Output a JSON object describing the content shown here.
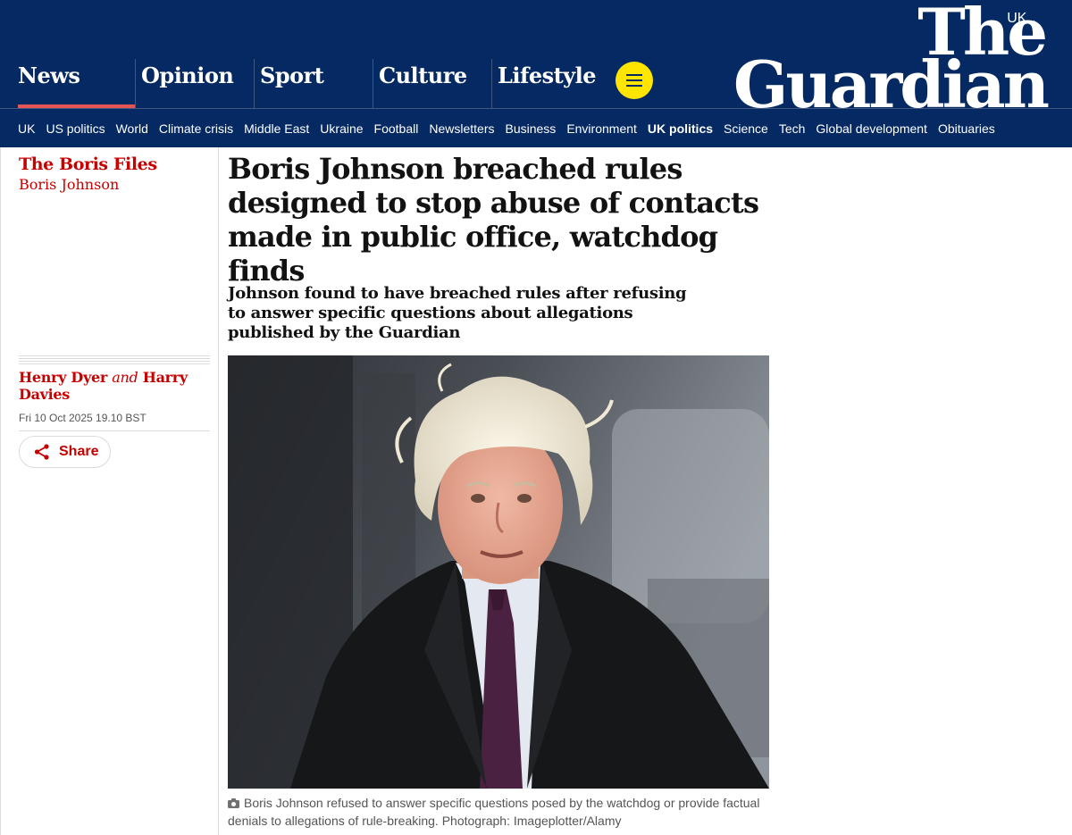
{
  "header": {
    "edition": "UK",
    "logo_line1": "The",
    "logo_line2": "Guardian",
    "pillars": [
      "News",
      "Opinion",
      "Sport",
      "Culture",
      "Lifestyle"
    ],
    "active_pillar": "News",
    "subnav": [
      "UK",
      "US politics",
      "World",
      "Climate crisis",
      "Middle East",
      "Ukraine",
      "Football",
      "Newsletters",
      "Business",
      "Environment",
      "UK politics",
      "Science",
      "Tech",
      "Global development",
      "Obituaries"
    ],
    "subnav_active": "UK politics"
  },
  "article": {
    "series": "The Boris Files",
    "series_tag": "Boris Johnson",
    "headline": "Boris Johnson breached rules designed to stop abuse of contacts made in public office, watchdog finds",
    "standfirst": "Johnson found to have breached rules after refusing to answer specific questions about allegations published by the Guardian",
    "author1": "Henry Dyer",
    "author_joiner": "and",
    "author2": "Harry Davies",
    "date": "Fri 10 Oct 2025 19.10 BST",
    "share_label": "Share",
    "caption": "Boris Johnson refused to answer specific questions posed by the watchdog or provide factual denials to allegations of rule-breaking. Photograph: Imageplotter/Alamy"
  },
  "colors": {
    "brand_blue": "#052962",
    "news_red": "#c70000",
    "active_underline": "#e45656",
    "menu_yellow": "#ffe500"
  },
  "icons": [
    "chevron-down-icon",
    "menu-icon",
    "share-icon",
    "camera-icon"
  ]
}
